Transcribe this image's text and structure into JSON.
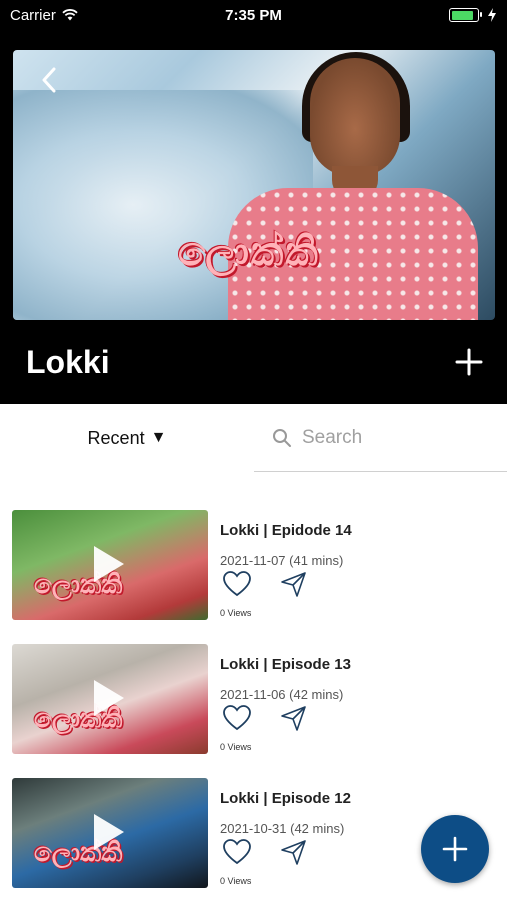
{
  "status_bar": {
    "carrier": "Carrier",
    "time": "7:35 PM",
    "battery_level": 0.85
  },
  "header": {
    "title": "Lokki",
    "hero_logo_text": "ලොක්කි"
  },
  "filter": {
    "sort_label": "Recent",
    "sort_arrow": "▼",
    "search_placeholder": "Search"
  },
  "episodes": [
    {
      "title": "Lokki | Epidode 14",
      "meta": "2021-11-07 (41 mins)",
      "views": "0 Views",
      "logo_text": "ලොක්කි"
    },
    {
      "title": "Lokki | Episode 13",
      "meta": "2021-11-06 (42 mins)",
      "views": "0 Views",
      "logo_text": "ලොක්කි"
    },
    {
      "title": "Lokki | Episode 12",
      "meta": "2021-10-31 (42 mins)",
      "views": "0 Views",
      "logo_text": "ලොක්කි"
    }
  ],
  "icons": {
    "back": "chevron-left-icon",
    "add": "plus-icon",
    "search": "search-icon",
    "like": "heart-icon",
    "share": "send-icon",
    "play": "play-icon",
    "fab": "plus-icon"
  },
  "colors": {
    "header_bg": "#000000",
    "fab_bg": "#0d4d86",
    "battery": "#4cd964"
  }
}
